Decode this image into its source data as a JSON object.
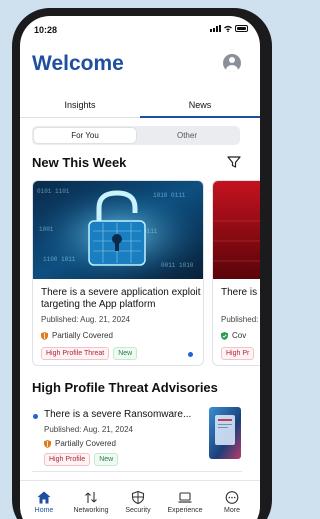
{
  "status": {
    "time": "10:28"
  },
  "header": {
    "title": "Welcome"
  },
  "main_tabs": [
    {
      "label": "Insights",
      "active": false
    },
    {
      "label": "News",
      "active": true
    }
  ],
  "segment": [
    {
      "label": "For You",
      "active": true
    },
    {
      "label": "Other",
      "active": false
    }
  ],
  "new_this_week": {
    "title": "New This Week",
    "cards": [
      {
        "title": "There is a severe application exploit targeting the App platform",
        "published": "Published: Aug. 21, 2024",
        "coverage": "Partially Covered",
        "tags": [
          "High Profile Threat",
          "New"
        ],
        "unread": true
      },
      {
        "title": "There is a severe exploit",
        "published": "Published:",
        "coverage": "Cov",
        "tags": [
          "High Pr"
        ]
      }
    ]
  },
  "advisories": {
    "title": "High Profile Threat Advisories",
    "items": [
      {
        "title": "There is a severe Ransomware...",
        "published": "Published: Aug. 21, 2024",
        "coverage": "Partially Covered",
        "tags": [
          "High Profile",
          "New"
        ]
      }
    ]
  },
  "bottom_nav": [
    {
      "label": "Home",
      "icon": "home-icon",
      "active": true
    },
    {
      "label": "Networking",
      "icon": "networking-icon",
      "active": false
    },
    {
      "label": "Security",
      "icon": "security-icon",
      "active": false
    },
    {
      "label": "Experience",
      "icon": "experience-icon",
      "active": false
    },
    {
      "label": "More",
      "icon": "more-icon",
      "active": false
    }
  ],
  "colors": {
    "brand": "#1f4fa0",
    "unread": "#1f63d6",
    "tag_red": "#b0243a",
    "tag_green": "#2a7d4b",
    "partial_shield": "#e07b1f",
    "covered_shield": "#2a9d55"
  }
}
